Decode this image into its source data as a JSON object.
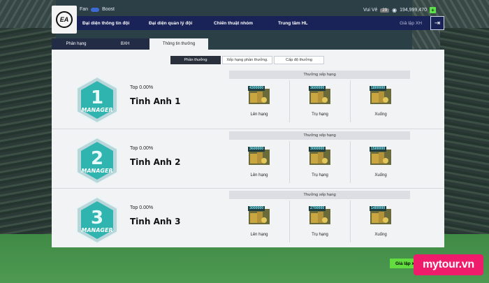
{
  "header": {
    "fan_label": "Fan",
    "boost_label": "Boost",
    "currency_label": "Vui Vẻ",
    "vip_badge": "29",
    "balance": "194,999,470",
    "bp_icon": "coin-icon"
  },
  "nav": {
    "items": [
      {
        "label": "Đại diện thông tin đội"
      },
      {
        "label": "Đại diện quản lý đội"
      },
      {
        "label": "Chiến thuật nhóm"
      },
      {
        "label": "Trung tâm HL"
      }
    ],
    "right_label": "Giả lập XH"
  },
  "tabs": [
    {
      "label": "Phân hạng"
    },
    {
      "label": "BXH"
    },
    {
      "label": "Thông tin thưởng",
      "active": true
    }
  ],
  "subtabs": [
    {
      "label": "Phần thưởng",
      "active": true
    },
    {
      "label": "Xếp hạng phần thưởng."
    },
    {
      "label": "Cấp độ thưởng"
    }
  ],
  "ranks": [
    {
      "badge_number": "1",
      "badge_text": "MANAGER",
      "top": "Top 0.00%",
      "name": "Tinh Anh 1",
      "reward_header": "Thưởng xếp hạng",
      "rewards": [
        {
          "amount": "4300000",
          "label": "Lên hạng"
        },
        {
          "amount": "3600000",
          "label": "Trụ hạng"
        },
        {
          "amount": "1800000",
          "label": "Xuống"
        }
      ]
    },
    {
      "badge_number": "2",
      "badge_text": "MANAGER",
      "top": "Top 0.00%",
      "name": "Tinh Anh 2",
      "reward_header": "Thưởng xếp hạng",
      "rewards": [
        {
          "amount": "3600000",
          "label": "Lên hạng"
        },
        {
          "amount": "3000000",
          "label": "Trụ hạng"
        },
        {
          "amount": "1500000",
          "label": "Xuống"
        }
      ]
    },
    {
      "badge_number": "3",
      "badge_text": "MANAGER",
      "top": "Top 0.00%",
      "name": "Tinh Anh 3",
      "reward_header": "Thưởng xếp hạng",
      "rewards": [
        {
          "amount": "3000000",
          "label": "Lên hạng"
        },
        {
          "amount": "2700000",
          "label": "Trụ hạng"
        },
        {
          "amount": "1400000",
          "label": "Xuống"
        }
      ]
    }
  ],
  "bottom_button": "Giả lập x",
  "watermark": "mytour.vn",
  "colors": {
    "nav_bg": "#1a2358",
    "panel_bg": "#f2f3f5",
    "badge_teal": "#2fb4b0",
    "accent_green": "#63dc3f",
    "watermark_pink": "#ee1c6b"
  }
}
